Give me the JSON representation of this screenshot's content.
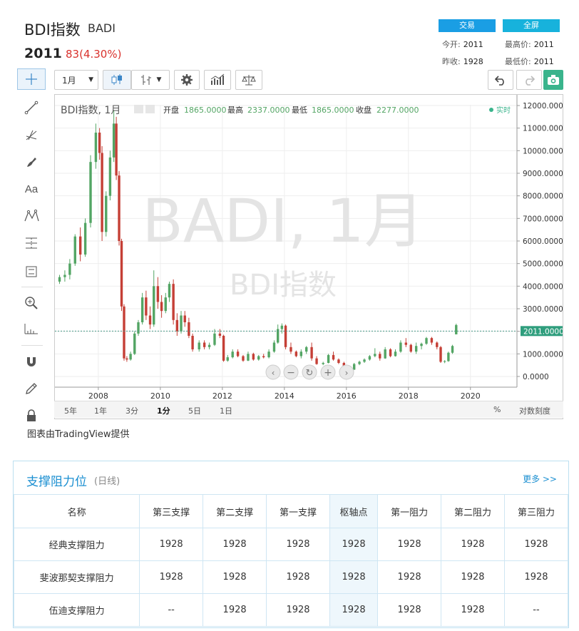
{
  "header": {
    "title": "BDI指数",
    "code": "BADI",
    "price": "2011",
    "change": "83(4.30%)",
    "trade_button": "交易",
    "fullscreen_button": "全屏",
    "quotes": [
      {
        "label": "今开:",
        "value": "2011"
      },
      {
        "label": "最高价:",
        "value": "2011"
      },
      {
        "label": "昨收:",
        "value": "1928"
      },
      {
        "label": "最低价:",
        "value": "2011"
      }
    ]
  },
  "toolbar": {
    "interval": "1月"
  },
  "chart_info": {
    "symbol_label": "BDI指数, 1月",
    "open_label": "开盘",
    "open_value": "1865.0000",
    "high_label": "最高",
    "high_value": "2337.0000",
    "low_label": "最低",
    "low_value": "1865.0000",
    "close_label": "收盘",
    "close_value": "2277.0000",
    "realtime_label": "实时",
    "watermark_main": "BADI, 1月",
    "watermark_sub": "BDI指数"
  },
  "timeframes": [
    "5年",
    "1年",
    "3分",
    "1分",
    "5日",
    "1日"
  ],
  "active_timeframe": "1分",
  "scale_labels": {
    "percent": "%",
    "log": "对数刻度"
  },
  "credit": "图表由TradingView提供",
  "colors": {
    "up": "#53a564",
    "down": "#c53f36",
    "current_line": "#4a9a86",
    "price_tag": "#2f9e7d"
  },
  "chart_data": {
    "type": "candlestick",
    "title": "BDI指数, 1月",
    "x_ticks": [
      "2008",
      "2010",
      "2012",
      "2014",
      "2016",
      "2018",
      "2020"
    ],
    "y_ticks": [
      "0.0000",
      "1000.0000",
      "2000.0000",
      "3000.0000",
      "4000.0000",
      "5000.0000",
      "6000.0000",
      "7000.0000",
      "8000.0000",
      "9000.0000",
      "10000.0000",
      "11000.0000",
      "12000.0000"
    ],
    "ylim": [
      0,
      12000
    ],
    "xlim": [
      2006.6,
      2021.5
    ],
    "current_price": "2011.0000",
    "current_value": 2011,
    "grid": true,
    "series": [
      {
        "t": 2006.75,
        "o": 4200,
        "h": 4500,
        "l": 4100,
        "c": 4400
      },
      {
        "t": 2006.92,
        "o": 4400,
        "h": 4700,
        "l": 4200,
        "c": 4500
      },
      {
        "t": 2007.08,
        "o": 4500,
        "h": 5200,
        "l": 4300,
        "c": 5000
      },
      {
        "t": 2007.25,
        "o": 5000,
        "h": 6300,
        "l": 4900,
        "c": 6200
      },
      {
        "t": 2007.42,
        "o": 6200,
        "h": 6600,
        "l": 5100,
        "c": 5400
      },
      {
        "t": 2007.58,
        "o": 5400,
        "h": 7000,
        "l": 5300,
        "c": 6800
      },
      {
        "t": 2007.75,
        "o": 6800,
        "h": 9800,
        "l": 6600,
        "c": 9500
      },
      {
        "t": 2007.92,
        "o": 9500,
        "h": 11200,
        "l": 9200,
        "c": 10800
      },
      {
        "t": 2008.04,
        "o": 10800,
        "h": 11000,
        "l": 9600,
        "c": 9900
      },
      {
        "t": 2008.12,
        "o": 9900,
        "h": 10200,
        "l": 6000,
        "c": 6400
      },
      {
        "t": 2008.25,
        "o": 6400,
        "h": 8200,
        "l": 6200,
        "c": 8000
      },
      {
        "t": 2008.38,
        "o": 8000,
        "h": 10000,
        "l": 7800,
        "c": 9700
      },
      {
        "t": 2008.5,
        "o": 9700,
        "h": 11800,
        "l": 9500,
        "c": 11200
      },
      {
        "t": 2008.58,
        "o": 11200,
        "h": 11500,
        "l": 8700,
        "c": 8900
      },
      {
        "t": 2008.67,
        "o": 8900,
        "h": 9100,
        "l": 5800,
        "c": 6000
      },
      {
        "t": 2008.75,
        "o": 6000,
        "h": 6100,
        "l": 2900,
        "c": 3100
      },
      {
        "t": 2008.83,
        "o": 3100,
        "h": 3200,
        "l": 700,
        "c": 800
      },
      {
        "t": 2008.92,
        "o": 800,
        "h": 900,
        "l": 650,
        "c": 750
      },
      {
        "t": 2009.04,
        "o": 750,
        "h": 1100,
        "l": 700,
        "c": 1000
      },
      {
        "t": 2009.17,
        "o": 1000,
        "h": 2000,
        "l": 950,
        "c": 1900
      },
      {
        "t": 2009.29,
        "o": 1900,
        "h": 2500,
        "l": 1800,
        "c": 2400
      },
      {
        "t": 2009.42,
        "o": 2400,
        "h": 3700,
        "l": 2300,
        "c": 3500
      },
      {
        "t": 2009.54,
        "o": 3500,
        "h": 3800,
        "l": 2500,
        "c": 2700
      },
      {
        "t": 2009.67,
        "o": 2700,
        "h": 3100,
        "l": 2100,
        "c": 2300
      },
      {
        "t": 2009.79,
        "o": 2300,
        "h": 4700,
        "l": 2200,
        "c": 4000
      },
      {
        "t": 2009.92,
        "o": 4000,
        "h": 4400,
        "l": 3000,
        "c": 3300
      },
      {
        "t": 2010.04,
        "o": 3300,
        "h": 3600,
        "l": 2600,
        "c": 2900
      },
      {
        "t": 2010.17,
        "o": 2900,
        "h": 3700,
        "l": 2800,
        "c": 3500
      },
      {
        "t": 2010.29,
        "o": 3500,
        "h": 4200,
        "l": 3300,
        "c": 4100
      },
      {
        "t": 2010.42,
        "o": 4100,
        "h": 4300,
        "l": 2300,
        "c": 2500
      },
      {
        "t": 2010.54,
        "o": 2500,
        "h": 2800,
        "l": 1800,
        "c": 2000
      },
      {
        "t": 2010.67,
        "o": 2000,
        "h": 2900,
        "l": 1900,
        "c": 2700
      },
      {
        "t": 2010.79,
        "o": 2700,
        "h": 2900,
        "l": 2200,
        "c": 2400
      },
      {
        "t": 2010.92,
        "o": 2400,
        "h": 2600,
        "l": 1700,
        "c": 1800
      },
      {
        "t": 2011.04,
        "o": 1800,
        "h": 1900,
        "l": 1100,
        "c": 1200
      },
      {
        "t": 2011.25,
        "o": 1200,
        "h": 1600,
        "l": 1100,
        "c": 1500
      },
      {
        "t": 2011.42,
        "o": 1500,
        "h": 1600,
        "l": 1200,
        "c": 1300
      },
      {
        "t": 2011.58,
        "o": 1300,
        "h": 1500,
        "l": 1200,
        "c": 1400
      },
      {
        "t": 2011.75,
        "o": 1400,
        "h": 2100,
        "l": 1350,
        "c": 1900
      },
      {
        "t": 2011.92,
        "o": 1900,
        "h": 2100,
        "l": 1700,
        "c": 1800
      },
      {
        "t": 2012.04,
        "o": 1800,
        "h": 1850,
        "l": 650,
        "c": 700
      },
      {
        "t": 2012.17,
        "o": 700,
        "h": 950,
        "l": 650,
        "c": 850
      },
      {
        "t": 2012.33,
        "o": 850,
        "h": 1200,
        "l": 800,
        "c": 1100
      },
      {
        "t": 2012.5,
        "o": 1100,
        "h": 1200,
        "l": 850,
        "c": 900
      },
      {
        "t": 2012.67,
        "o": 900,
        "h": 950,
        "l": 650,
        "c": 700
      },
      {
        "t": 2012.83,
        "o": 700,
        "h": 1100,
        "l": 680,
        "c": 1000
      },
      {
        "t": 2013.0,
        "o": 1000,
        "h": 1050,
        "l": 700,
        "c": 750
      },
      {
        "t": 2013.17,
        "o": 750,
        "h": 950,
        "l": 700,
        "c": 900
      },
      {
        "t": 2013.33,
        "o": 900,
        "h": 1000,
        "l": 800,
        "c": 850
      },
      {
        "t": 2013.5,
        "o": 850,
        "h": 1200,
        "l": 800,
        "c": 1100
      },
      {
        "t": 2013.67,
        "o": 1100,
        "h": 1600,
        "l": 1050,
        "c": 1500
      },
      {
        "t": 2013.79,
        "o": 1500,
        "h": 2300,
        "l": 1450,
        "c": 2100
      },
      {
        "t": 2013.92,
        "o": 2100,
        "h": 2350,
        "l": 1900,
        "c": 2250
      },
      {
        "t": 2014.04,
        "o": 2250,
        "h": 2300,
        "l": 1200,
        "c": 1300
      },
      {
        "t": 2014.21,
        "o": 1300,
        "h": 1500,
        "l": 1000,
        "c": 1100
      },
      {
        "t": 2014.38,
        "o": 1100,
        "h": 1150,
        "l": 850,
        "c": 900
      },
      {
        "t": 2014.54,
        "o": 900,
        "h": 1200,
        "l": 800,
        "c": 1100
      },
      {
        "t": 2014.71,
        "o": 1100,
        "h": 1350,
        "l": 1000,
        "c": 1300
      },
      {
        "t": 2014.88,
        "o": 1300,
        "h": 1500,
        "l": 700,
        "c": 800
      },
      {
        "t": 2015.04,
        "o": 800,
        "h": 900,
        "l": 520,
        "c": 550
      },
      {
        "t": 2015.25,
        "o": 550,
        "h": 650,
        "l": 500,
        "c": 600
      },
      {
        "t": 2015.42,
        "o": 600,
        "h": 1000,
        "l": 580,
        "c": 950
      },
      {
        "t": 2015.58,
        "o": 950,
        "h": 1100,
        "l": 700,
        "c": 750
      },
      {
        "t": 2015.75,
        "o": 750,
        "h": 800,
        "l": 550,
        "c": 600
      },
      {
        "t": 2015.92,
        "o": 600,
        "h": 650,
        "l": 420,
        "c": 450
      },
      {
        "t": 2016.08,
        "o": 450,
        "h": 480,
        "l": 290,
        "c": 300
      },
      {
        "t": 2016.25,
        "o": 300,
        "h": 600,
        "l": 290,
        "c": 550
      },
      {
        "t": 2016.42,
        "o": 550,
        "h": 700,
        "l": 500,
        "c": 650
      },
      {
        "t": 2016.58,
        "o": 650,
        "h": 800,
        "l": 600,
        "c": 750
      },
      {
        "t": 2016.75,
        "o": 750,
        "h": 950,
        "l": 700,
        "c": 900
      },
      {
        "t": 2016.92,
        "o": 900,
        "h": 1250,
        "l": 850,
        "c": 1000
      },
      {
        "t": 2017.08,
        "o": 1000,
        "h": 1100,
        "l": 700,
        "c": 800
      },
      {
        "t": 2017.25,
        "o": 800,
        "h": 1300,
        "l": 780,
        "c": 1200
      },
      {
        "t": 2017.42,
        "o": 1200,
        "h": 1250,
        "l": 850,
        "c": 900
      },
      {
        "t": 2017.58,
        "o": 900,
        "h": 1200,
        "l": 880,
        "c": 1100
      },
      {
        "t": 2017.75,
        "o": 1100,
        "h": 1600,
        "l": 1050,
        "c": 1500
      },
      {
        "t": 2017.92,
        "o": 1500,
        "h": 1700,
        "l": 1300,
        "c": 1400
      },
      {
        "t": 2018.08,
        "o": 1400,
        "h": 1450,
        "l": 1050,
        "c": 1100
      },
      {
        "t": 2018.25,
        "o": 1100,
        "h": 1500,
        "l": 1000,
        "c": 1350
      },
      {
        "t": 2018.42,
        "o": 1350,
        "h": 1500,
        "l": 1200,
        "c": 1450
      },
      {
        "t": 2018.58,
        "o": 1450,
        "h": 1750,
        "l": 1400,
        "c": 1700
      },
      {
        "t": 2018.75,
        "o": 1700,
        "h": 1750,
        "l": 1400,
        "c": 1500
      },
      {
        "t": 2018.92,
        "o": 1500,
        "h": 1550,
        "l": 1200,
        "c": 1300
      },
      {
        "t": 2019.04,
        "o": 1300,
        "h": 1350,
        "l": 600,
        "c": 650
      },
      {
        "t": 2019.17,
        "o": 650,
        "h": 720,
        "l": 590,
        "c": 680
      },
      {
        "t": 2019.29,
        "o": 680,
        "h": 1100,
        "l": 650,
        "c": 1050
      },
      {
        "t": 2019.42,
        "o": 1050,
        "h": 1400,
        "l": 1000,
        "c": 1350
      },
      {
        "t": 2019.54,
        "o": 1865,
        "h": 2337,
        "l": 1865,
        "c": 2277
      }
    ]
  },
  "sr": {
    "title": "支撑阻力位",
    "subtitle": "(日线)",
    "more": "更多 >>",
    "headers": [
      "名称",
      "第三支撑",
      "第二支撑",
      "第一支撑",
      "枢轴点",
      "第一阻力",
      "第二阻力",
      "第三阻力"
    ],
    "rows": [
      [
        "经典支撑阻力",
        "1928",
        "1928",
        "1928",
        "1928",
        "1928",
        "1928",
        "1928"
      ],
      [
        "斐波那契支撑阻力",
        "1928",
        "1928",
        "1928",
        "1928",
        "1928",
        "1928",
        "1928"
      ],
      [
        "伍迪支撑阻力",
        "--",
        "1928",
        "1928",
        "1928",
        "1928",
        "1928",
        "--"
      ]
    ]
  }
}
